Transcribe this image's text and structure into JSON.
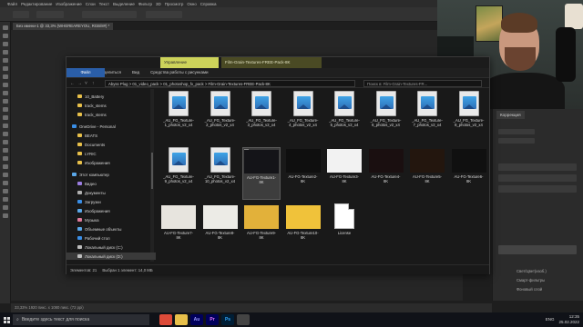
{
  "photoshop": {
    "menu": [
      "Файл",
      "Редактирование",
      "Изображение",
      "Слои",
      "Текст",
      "Выделение",
      "Фильтр",
      "3D",
      "Просмотр",
      "Окно",
      "Справка"
    ],
    "doc_tab": "Без имени-1 @ 33,3% (WHEREAREYOU, RGB/8#) *",
    "panel_tab": "Коррекция",
    "layer_labels": [
      "Свет/Цвет(изоб.)",
      "Смарт-фильтры",
      "Фоновый слой"
    ],
    "status": "33,33%   1920 пикс. x 1080 пикс. (72 ppi)"
  },
  "explorer": {
    "ribbon_context_tab": "Управление",
    "window_title": "Film-Grain-Textures-FREE-Pack-8K",
    "ribbon_tabs": [
      "Файл",
      "Главная",
      "Поделиться",
      "Вид",
      "Средства работы с рисунками"
    ],
    "address_path": "Abyss Plug  >  01_video_pack  >  01_photoshop_fx_pack  >  Film-Grain-Textures-FREE-Pack-8K",
    "search_placeholder": "Поиск в: Film-Grain-Textures-FR...",
    "nav_items": [
      {
        "label": "10_Battery",
        "icon": "folder",
        "color": "#e8c04a"
      },
      {
        "label": "track_stems",
        "icon": "folder",
        "color": "#e8c04a"
      },
      {
        "label": "track_stems",
        "icon": "folder",
        "color": "#e8c04a"
      },
      {
        "label": "OneDrive - Personal",
        "icon": "cloud",
        "color": "#3a8ee6"
      },
      {
        "label": "BEATS",
        "icon": "folder",
        "color": "#e8c04a"
      },
      {
        "label": "Documents",
        "icon": "folder",
        "color": "#e8c04a"
      },
      {
        "label": "LYRIC",
        "icon": "folder",
        "color": "#e8c04a"
      },
      {
        "label": "Изображения",
        "icon": "folder",
        "color": "#e8c04a"
      },
      {
        "label": "Этот компьютер",
        "icon": "pc",
        "color": "#5aa7e8"
      },
      {
        "label": "Видео",
        "icon": "folder",
        "color": "#9b7de0"
      },
      {
        "label": "Документы",
        "icon": "folder",
        "color": "#b0b0b0"
      },
      {
        "label": "Загрузки",
        "icon": "folder",
        "color": "#3a8ee6"
      },
      {
        "label": "Изображения",
        "icon": "folder",
        "color": "#5aa7e8"
      },
      {
        "label": "Музыка",
        "icon": "folder",
        "color": "#e07a9b"
      },
      {
        "label": "Объемные объекты",
        "icon": "folder",
        "color": "#5aa7e8"
      },
      {
        "label": "Рабочий стол",
        "icon": "folder",
        "color": "#3a8ee6"
      },
      {
        "label": "Локальный диск (C:)",
        "icon": "drive",
        "color": "#bdbdbd"
      },
      {
        "label": "Локальный диск (D:)",
        "icon": "drive",
        "color": "#bdbdbd"
      }
    ],
    "files": [
      {
        "label": "_AU_FG_Texture-\n1_photos_v2_x4",
        "kind": "img-icon"
      },
      {
        "label": "_AU_FG_Texture-\n2_photos_v2_x4",
        "kind": "img-icon"
      },
      {
        "label": "_AU_FG_Texture-\n3_photos_v2_x4",
        "kind": "img-icon"
      },
      {
        "label": "_AU_FG_Texture-\n4_photos_v2_x4",
        "kind": "img-icon"
      },
      {
        "label": "_AU_FG_Texture-\n5_photos_v2_x4",
        "kind": "img-icon"
      },
      {
        "label": "_AU_FG_Texture-\n6_photos_v2_x4",
        "kind": "img-icon"
      },
      {
        "label": "_AU_FG_Texture-\n7_photos_v2_x4",
        "kind": "img-icon"
      },
      {
        "label": "_AU_FG_Texture-\n8_photos_v2_x4",
        "kind": "img-icon"
      },
      {
        "label": "_AU_FG_Texture-\n9_photos_v2_x4",
        "kind": "img-icon"
      },
      {
        "label": "_AU_FG_Texture-\n10_photos_v2_x4",
        "kind": "img-icon"
      },
      {
        "label": "AU-FG-Texture1-\n8K",
        "kind": "photo",
        "tone": "#141418",
        "selected": true
      },
      {
        "label": "AU-FG-Texture2-\n8K",
        "kind": "photo",
        "tone": "#0f0f0f"
      },
      {
        "label": "AU-FG-Texture3-\n8K",
        "kind": "photo",
        "tone": "#f2f2f2"
      },
      {
        "label": "AU-FG-Texture4-\n8K",
        "kind": "photo",
        "tone": "#1a0f10"
      },
      {
        "label": "AU-FG-Texture5-\n8K",
        "kind": "photo",
        "tone": "#23160e"
      },
      {
        "label": "AU-FG-Texture6-\n8K",
        "kind": "photo",
        "tone": "#101010"
      },
      {
        "label": "AU-FG-Texture7-\n8K",
        "kind": "photo",
        "tone": "#e7e4de"
      },
      {
        "label": "AU-FG-Texture8-\n8K",
        "kind": "photo",
        "tone": "#ecebe6"
      },
      {
        "label": "AU-FG-Texture9-\n8K",
        "kind": "photo",
        "tone": "#e2b13a"
      },
      {
        "label": "AU-FG-Texture10-\n8K",
        "kind": "photo",
        "tone": "#f0c23a"
      },
      {
        "label": "License",
        "kind": "doc"
      }
    ],
    "status_count": "Элементов: 21",
    "status_selected": "Выбран 1 элемент: 14,0 МБ"
  },
  "taskbar": {
    "search_placeholder": "Введите здесь текст для поиска",
    "apps": [
      {
        "name": "chrome",
        "label": "",
        "bg": "#dd4b39",
        "fg": "#ffffff"
      },
      {
        "name": "folder",
        "label": "",
        "bg": "#e8c04a",
        "fg": "#333"
      },
      {
        "name": "audition",
        "label": "Au",
        "bg": "#00005b",
        "fg": "#9999ff"
      },
      {
        "name": "premiere",
        "label": "Pr",
        "bg": "#00005b",
        "fg": "#ea77ff"
      },
      {
        "name": "photoshop",
        "label": "Ps",
        "bg": "#001e36",
        "fg": "#31a8ff"
      },
      {
        "name": "media",
        "label": "",
        "bg": "#444",
        "fg": "#ddd"
      }
    ],
    "lang": "ENG",
    "time": "12:35",
    "date": "25.02.2022"
  },
  "colors": {
    "accent_file_tab": "#2a5ea8",
    "ribbon_context": "#cdd35a"
  }
}
